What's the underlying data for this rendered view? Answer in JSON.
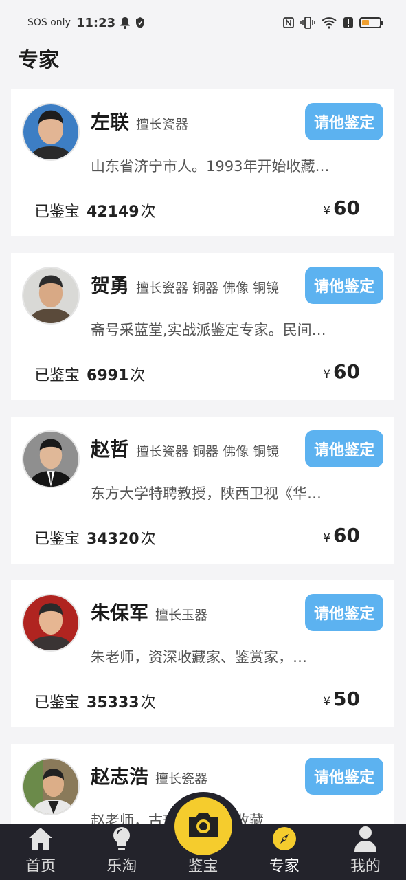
{
  "status_bar": {
    "carrier": "SOS only",
    "time": "11:23",
    "icons": [
      "bell-icon",
      "shield-icon",
      "nfc-icon",
      "vibrate-icon",
      "wifi-icon",
      "alert-icon",
      "battery-icon"
    ],
    "battery_color": "#f0a030"
  },
  "page": {
    "title": "专家"
  },
  "consult_label": "请他鉴定",
  "count_label": "已鉴宝",
  "count_unit": "次",
  "currency": "¥",
  "experts": [
    {
      "name": "左联",
      "specialty": "擅长瓷器",
      "bio": "山东省济宁市人。1993年开始收藏…",
      "count": "42149",
      "price": "60"
    },
    {
      "name": "贺勇",
      "specialty": "擅长瓷器 铜器 佛像 铜镜",
      "bio": "斋号采蓝堂,实战派鉴定专家。民间…",
      "count": "6991",
      "price": "60"
    },
    {
      "name": "赵哲",
      "specialty": "擅长瓷器 铜器 佛像 铜镜",
      "bio": "东方大学特聘教授，陕西卫视《华…",
      "count": "34320",
      "price": "60"
    },
    {
      "name": "朱保军",
      "specialty": "擅长玉器",
      "bio": "朱老师，资深收藏家、鉴赏家，…",
      "count": "35333",
      "price": "50"
    },
    {
      "name": "赵志浩",
      "specialty": "擅长瓷器",
      "bio": "赵老师，古玩鉴赏家，收藏…",
      "count": "",
      "price": ""
    }
  ],
  "tabbar": {
    "items": [
      {
        "label": "首页",
        "icon": "home-icon"
      },
      {
        "label": "乐淘",
        "icon": "lightbulb-icon"
      },
      {
        "label": "鉴宝",
        "icon": "camera-icon"
      },
      {
        "label": "专家",
        "icon": "compass-icon"
      },
      {
        "label": "我的",
        "icon": "person-icon"
      }
    ],
    "active": "专家",
    "accent": "#f5cc2d",
    "background": "#23232b"
  },
  "colors": {
    "button": "#5cb2f0",
    "background": "#f4f4f6"
  }
}
